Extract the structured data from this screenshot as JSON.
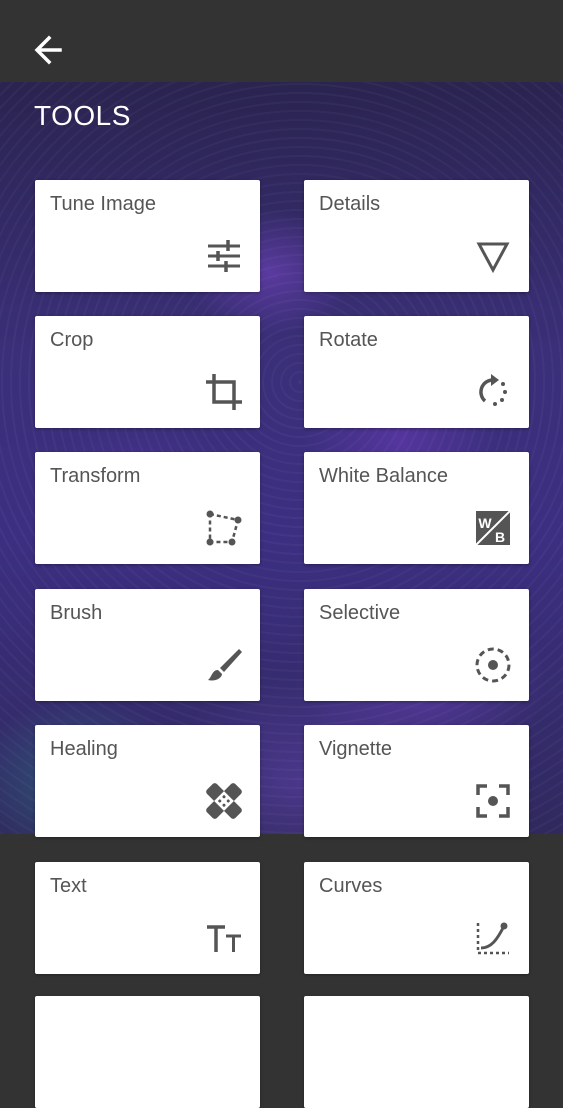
{
  "header": {
    "back_icon": "arrow-left-icon"
  },
  "page": {
    "title": "TOOLS"
  },
  "tools": [
    {
      "label": "Tune Image",
      "icon": "sliders-icon"
    },
    {
      "label": "Details",
      "icon": "triangle-down-icon"
    },
    {
      "label": "Crop",
      "icon": "crop-icon"
    },
    {
      "label": "Rotate",
      "icon": "rotate-icon"
    },
    {
      "label": "Transform",
      "icon": "transform-icon"
    },
    {
      "label": "White Balance",
      "icon": "white-balance-icon",
      "icon_text_top": "W",
      "icon_text_bottom": "B"
    },
    {
      "label": "Brush",
      "icon": "brush-icon"
    },
    {
      "label": "Selective",
      "icon": "selective-icon"
    },
    {
      "label": "Healing",
      "icon": "healing-icon"
    },
    {
      "label": "Vignette",
      "icon": "vignette-icon"
    },
    {
      "label": "Text",
      "icon": "text-icon"
    },
    {
      "label": "Curves",
      "icon": "curves-icon"
    }
  ]
}
